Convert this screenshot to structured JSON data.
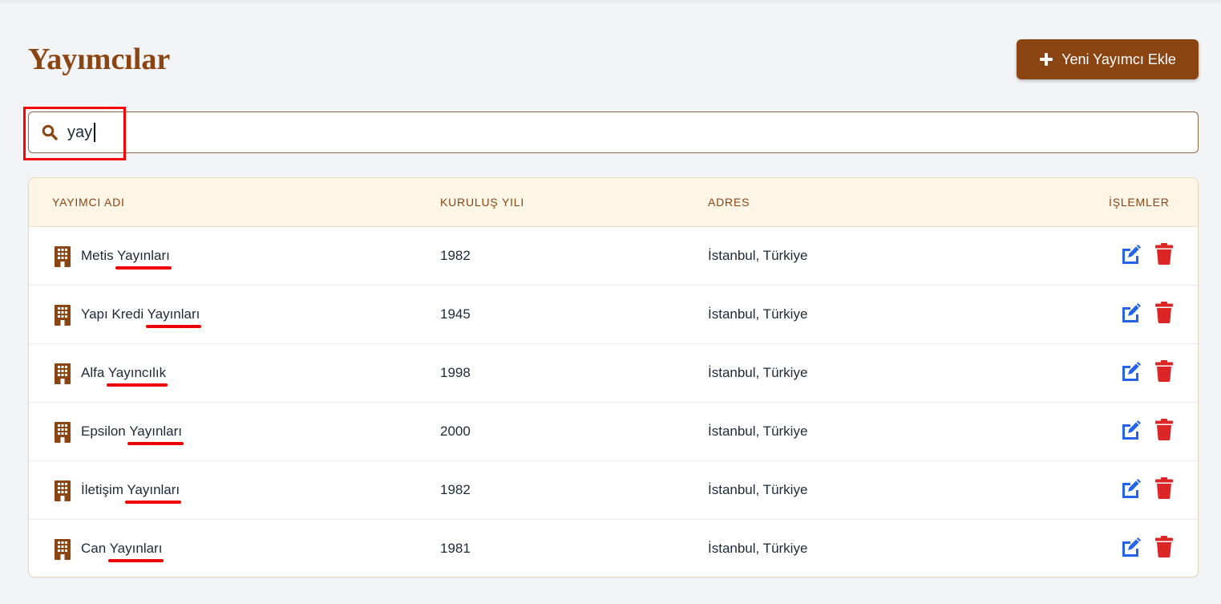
{
  "page": {
    "title": "Yayımcılar",
    "add_button_label": "Yeni Yayımcı Ekle"
  },
  "search": {
    "value": "yay",
    "placeholder": ""
  },
  "table": {
    "headers": [
      "YAYIMCI ADI",
      "KURULUŞ YILI",
      "ADRES",
      "İŞLEMLER"
    ],
    "rows": [
      {
        "name_prefix": "Metis ",
        "name_match": "Yayınları",
        "year": "1982",
        "address": "İstanbul, Türkiye"
      },
      {
        "name_prefix": "Yapı Kredi ",
        "name_match": "Yayınları",
        "year": "1945",
        "address": "İstanbul, Türkiye"
      },
      {
        "name_prefix": "Alfa ",
        "name_match": "Yayıncılık",
        "year": "1998",
        "address": "İstanbul, Türkiye"
      },
      {
        "name_prefix": "Epsilon ",
        "name_match": "Yayınları",
        "year": "2000",
        "address": "İstanbul, Türkiye"
      },
      {
        "name_prefix": "İletişim ",
        "name_match": "Yayınları",
        "year": "1982",
        "address": "İstanbul, Türkiye"
      },
      {
        "name_prefix": "Can ",
        "name_match": "Yayınları",
        "year": "1981",
        "address": "İstanbul, Türkiye"
      }
    ]
  },
  "colors": {
    "brand": "#8b4513",
    "edit": "#2563eb",
    "delete": "#dc2626",
    "annotation": "#ff0000"
  },
  "icons": {
    "add": "plus-icon",
    "search": "search-icon",
    "row": "building-icon",
    "edit": "edit-icon",
    "delete": "trash-icon"
  }
}
